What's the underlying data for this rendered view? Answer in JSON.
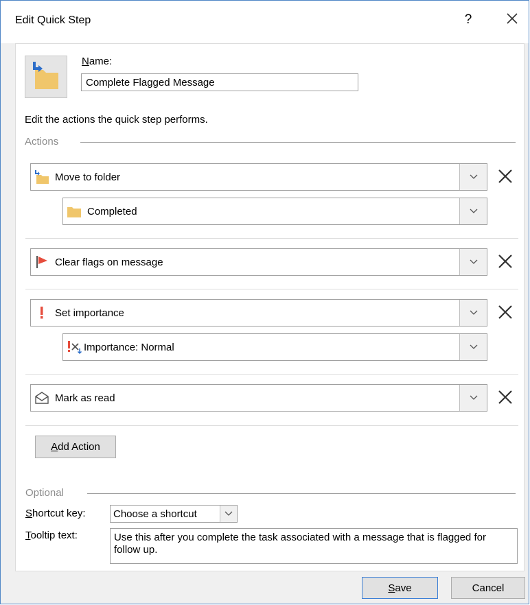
{
  "dialog": {
    "title": "Edit Quick Step",
    "help_label": "?"
  },
  "name": {
    "label_first": "N",
    "label_rest": "ame:",
    "value": "Complete Flagged Message"
  },
  "instructions": "Edit the actions the quick step performs.",
  "actions_group_label": "Actions",
  "actions": [
    {
      "icon": "move-to-folder-icon",
      "label": "Move to folder",
      "sub": {
        "icon": "folder-icon",
        "label": "Completed"
      }
    },
    {
      "icon": "red-flag-icon",
      "label": "Clear flags on message"
    },
    {
      "icon": "exclamation-icon",
      "label": "Set importance",
      "sub": {
        "icon": "importance-normal-icon",
        "label": "Importance: Normal"
      }
    },
    {
      "icon": "envelope-open-icon",
      "label": "Mark as read"
    }
  ],
  "add_action": {
    "first": "A",
    "rest": "dd Action"
  },
  "optional_group_label": "Optional",
  "shortcut": {
    "label_first": "S",
    "label_rest": "hortcut key:",
    "value": "Choose a shortcut"
  },
  "tooltip": {
    "label_first": "T",
    "label_rest": "ooltip text:",
    "value": "Use this after you complete the task associated with a message that is flagged for follow up."
  },
  "buttons": {
    "save_first": "S",
    "save_rest": "ave",
    "cancel": "Cancel"
  },
  "colors": {
    "accent": "#4f86c6",
    "folder": "#f0c66b",
    "flag": "#e64d3d",
    "arrow": "#2d6ec9"
  }
}
